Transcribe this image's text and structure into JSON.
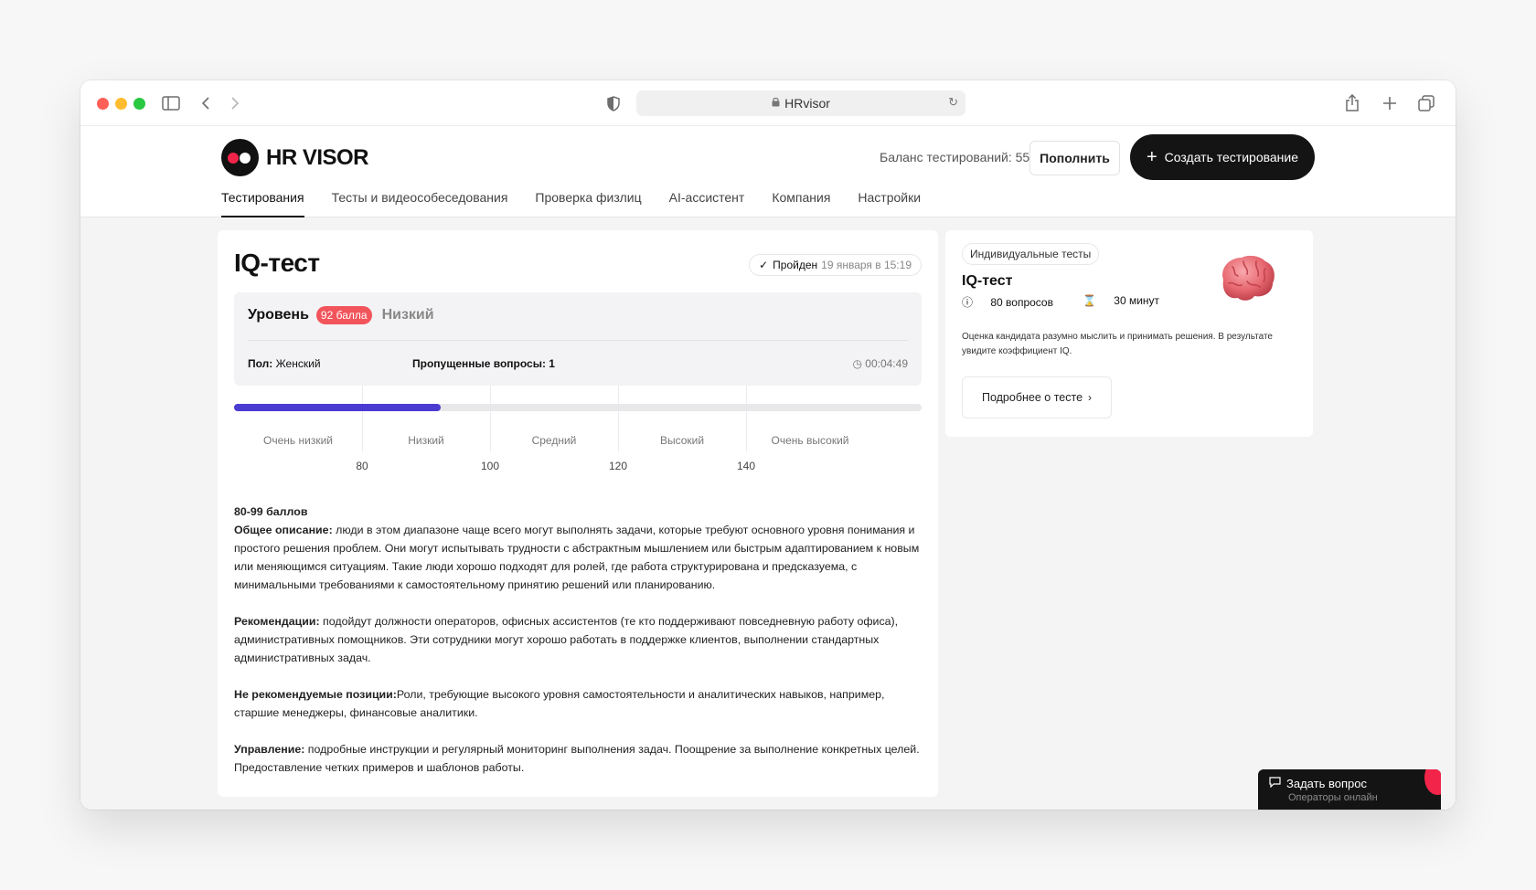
{
  "browser": {
    "url": "HRvisor",
    "icons": [
      "sidebar-icon",
      "back-icon",
      "forward-icon",
      "shield-icon",
      "lock-icon",
      "reload-icon",
      "share-icon",
      "new-tab-icon",
      "tabs-icon"
    ]
  },
  "header": {
    "logo_text": "HR VISOR",
    "balance": "Баланс тестирований: 55",
    "topup_label": "Пополнить",
    "create_label": "Создать тестирование",
    "nav": [
      "Тестирования",
      "Тесты и видеособеседования",
      "Проверка физлиц",
      "AI-ассистент",
      "Компания",
      "Настройки"
    ],
    "active_nav": 0
  },
  "result": {
    "title": "IQ-тест",
    "status": "Пройден",
    "date": "19 января в 15:19",
    "level_label": "Уровень",
    "score_badge": "92 балла",
    "level_value": "Низкий",
    "gender_label": "Пол:",
    "gender_value": "Женский",
    "skipped": "Пропущенные вопросы: 1",
    "duration": "00:04:49"
  },
  "scale": {
    "segments": [
      "Очень низкий",
      "Низкий",
      "Средний",
      "Высокий",
      "Очень высокий"
    ],
    "ticks": [
      "80",
      "100",
      "120",
      "140"
    ],
    "progress_fraction": 0.3
  },
  "description": {
    "range": "80-99 баллов",
    "general_label": "Общее описание:",
    "general_text": " люди в этом диапазоне чаще всего могут выполнять задачи, которые требуют основного уровня понимания и простого решения проблем. Они могут испытывать трудности с абстрактным мышлением или быстрым адаптированием к новым или меняющимся ситуациям. Такие люди хорошо подходят для ролей, где работа структурирована и предсказуема, с минимальными требованиями к самостоятельному принятию решений или планированию.",
    "recommend_label": "Рекомендации:",
    "recommend_text": " подойдут должности операторов, офисных ассистентов (те кто поддерживают повседневную работу офиса), административных помощников. Эти сотрудники могут хорошо работать в поддержке клиентов, выполнении стандартных административных задач.",
    "not_recommended_label": "Не рекомендуемые позиции:",
    "not_recommended_text": "Роли, требующие высокого уровня самостоятельности и аналитических навыков, например, старшие менеджеры, финансовые аналитики.",
    "management_label": "Управление:",
    "management_text": " подробные инструкции и регулярный мониторинг выполнения задач. Поощрение за выполнение конкретных целей. Предоставление четких примеров и шаблонов работы."
  },
  "side": {
    "chip": "Индивидуальные тесты",
    "title": "IQ-тест",
    "questions": "80 вопросов",
    "duration": "30 минут",
    "description": "Оценка кандидата разумно мыслить и принимать решения. В результате увидите коэффициент IQ.",
    "more_label": "Подробнее о тесте"
  },
  "chat": {
    "title": "Задать вопрос",
    "subtitle": "Операторы онлайн"
  },
  "colors": {
    "accent": "#4a3bd1",
    "badge": "#f2545b",
    "brand_red": "#f3244a"
  }
}
